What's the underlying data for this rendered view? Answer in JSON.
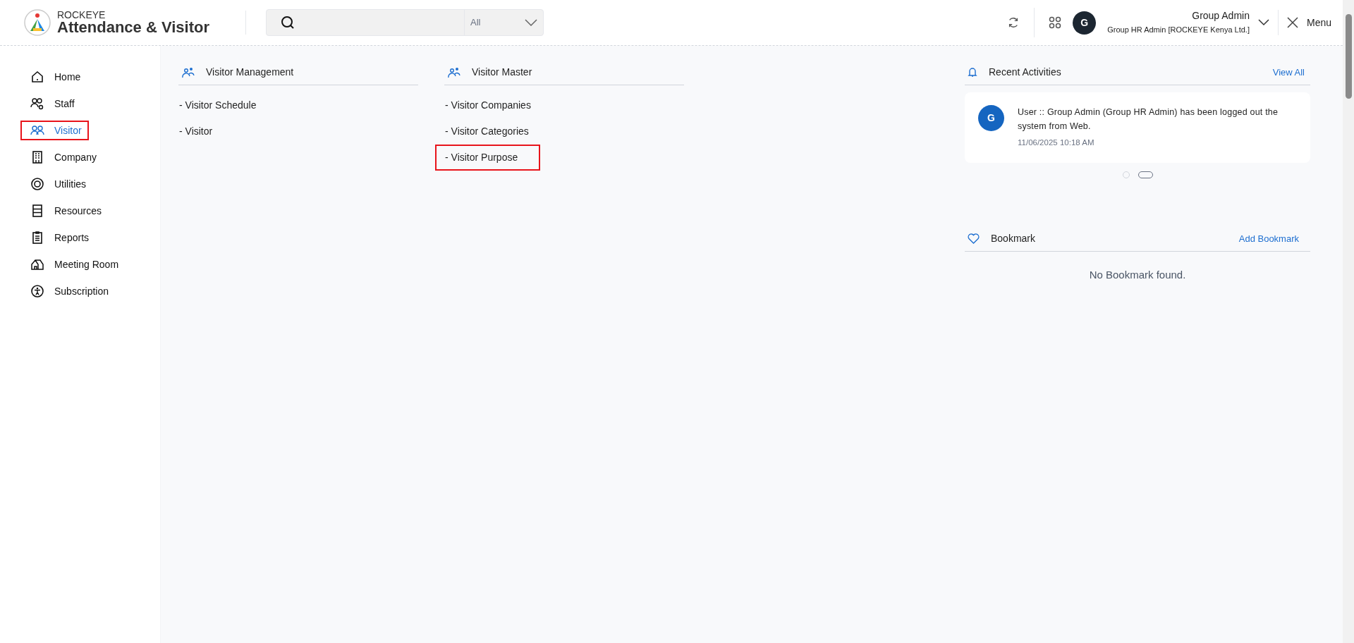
{
  "brand": {
    "company": "ROCKEYE",
    "product": "Attendance & Visitor"
  },
  "search": {
    "filter": "All"
  },
  "user": {
    "initial": "G",
    "name": "Group Admin",
    "role": "Group HR Admin [ROCKEYE Kenya Ltd.]"
  },
  "menu_button": "Menu",
  "sidebar": {
    "items": [
      {
        "label": "Home",
        "selected": false,
        "highlighted": false
      },
      {
        "label": "Staff",
        "selected": false,
        "highlighted": false
      },
      {
        "label": "Visitor",
        "selected": true,
        "highlighted": true
      },
      {
        "label": "Company",
        "selected": false,
        "highlighted": false
      },
      {
        "label": "Utilities",
        "selected": false,
        "highlighted": false
      },
      {
        "label": "Resources",
        "selected": false,
        "highlighted": false
      },
      {
        "label": "Reports",
        "selected": false,
        "highlighted": false
      },
      {
        "label": "Meeting Room",
        "selected": false,
        "highlighted": false
      },
      {
        "label": "Subscription",
        "selected": false,
        "highlighted": false
      }
    ]
  },
  "sections": [
    {
      "title": "Visitor Management",
      "items": [
        {
          "label": "- Visitor Schedule",
          "highlighted": false
        },
        {
          "label": "- Visitor",
          "highlighted": false
        }
      ]
    },
    {
      "title": "Visitor Master",
      "items": [
        {
          "label": "- Visitor Companies",
          "highlighted": false
        },
        {
          "label": "- Visitor Categories",
          "highlighted": false
        },
        {
          "label": "- Visitor Purpose",
          "highlighted": true
        }
      ]
    }
  ],
  "recent_activities": {
    "title": "Recent Activities",
    "link": "View All",
    "items": [
      {
        "initial": "G",
        "message": "User :: Group Admin (Group HR Admin) has been logged out the system from Web.",
        "time": "11/06/2025 10:18 AM"
      }
    ],
    "carousel": [
      {
        "selected": false
      },
      {
        "selected": true
      }
    ]
  },
  "bookmark": {
    "title": "Bookmark",
    "link": "Add Bookmark",
    "empty": "No Bookmark found."
  }
}
